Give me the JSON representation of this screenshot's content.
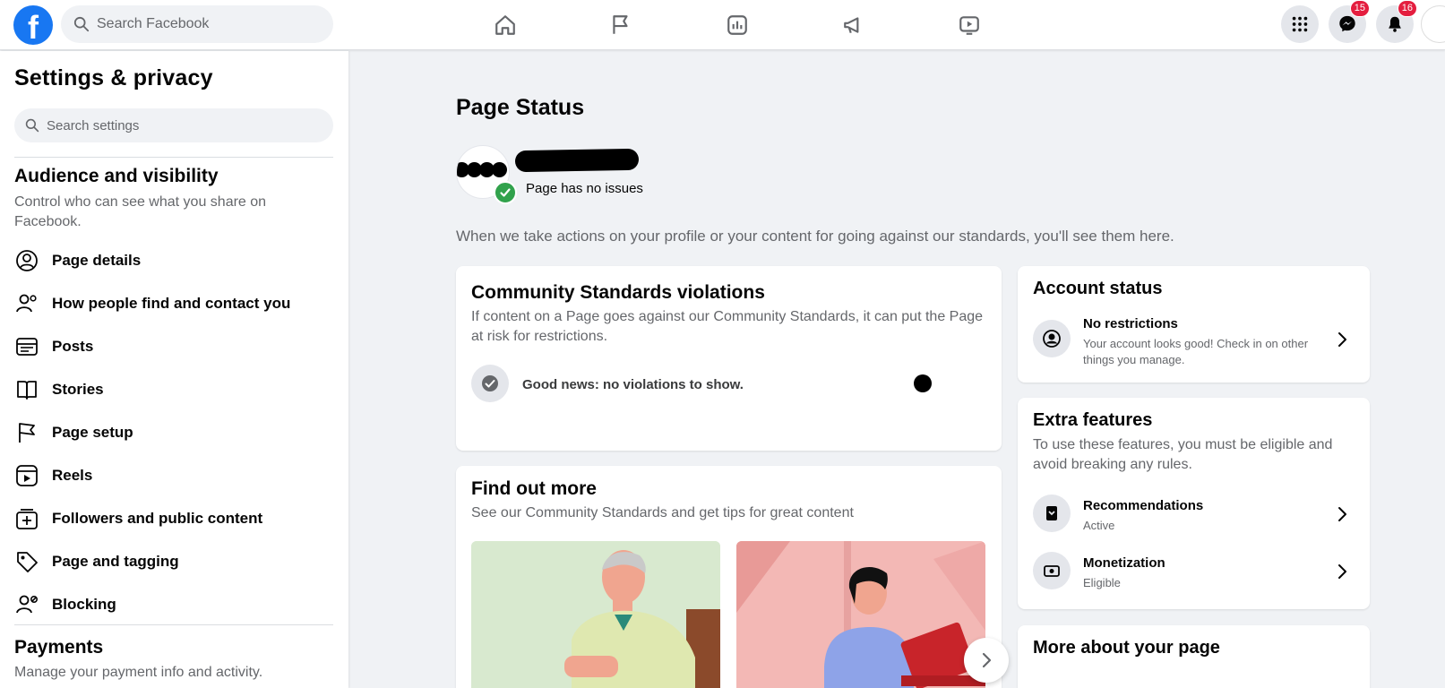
{
  "topbar": {
    "logo": "f",
    "search_placeholder": "Search Facebook",
    "nav_icons": [
      "home-icon",
      "flag-icon",
      "insights-icon",
      "megaphone-icon",
      "video-icon"
    ],
    "messenger_badge": "15",
    "notifications_badge": "16"
  },
  "sidebar": {
    "title": "Settings & privacy",
    "search_placeholder": "Search settings",
    "section1": {
      "title": "Audience and visibility",
      "desc": "Control who can see what you share on Facebook."
    },
    "items": [
      {
        "label": "Page details",
        "icon": "person-circle-icon"
      },
      {
        "label": "How people find and contact you",
        "icon": "people-icon"
      },
      {
        "label": "Posts",
        "icon": "posts-icon"
      },
      {
        "label": "Stories",
        "icon": "book-icon"
      },
      {
        "label": "Page setup",
        "icon": "flag-icon"
      },
      {
        "label": "Reels",
        "icon": "reels-icon"
      },
      {
        "label": "Followers and public content",
        "icon": "followers-icon"
      },
      {
        "label": "Page and tagging",
        "icon": "tag-icon"
      },
      {
        "label": "Blocking",
        "icon": "block-icon"
      }
    ],
    "section2": {
      "title": "Payments",
      "desc": "Manage your payment info and activity."
    }
  },
  "main": {
    "title": "Page Status",
    "page_status_text": "Page has no issues",
    "description": "When we take actions on your profile or your content for going against our standards, you'll see them here.",
    "violations": {
      "title": "Community Standards violations",
      "desc": "If content on a Page goes against our Community Standards, it can put the Page at risk for restrictions.",
      "good_news": "Good news: no violations to show."
    },
    "find_more": {
      "title": "Find out more",
      "desc": "See our Community Standards and get tips for great content"
    },
    "account_status": {
      "title": "Account status",
      "row_title": "No restrictions",
      "row_sub": "Your account looks good! Check in on other things you manage."
    },
    "extra_features": {
      "title": "Extra features",
      "desc": "To use these features, you must be eligible and avoid breaking any rules.",
      "rows": [
        {
          "title": "Recommendations",
          "sub": "Active",
          "icon": "recommendations-icon"
        },
        {
          "title": "Monetization",
          "sub": "Eligible",
          "icon": "monetization-icon"
        }
      ]
    },
    "more_about": {
      "title": "More about your page"
    }
  },
  "colors": {
    "brand": "#1877f2",
    "success": "#31a24c",
    "badge": "#e41e3f"
  }
}
